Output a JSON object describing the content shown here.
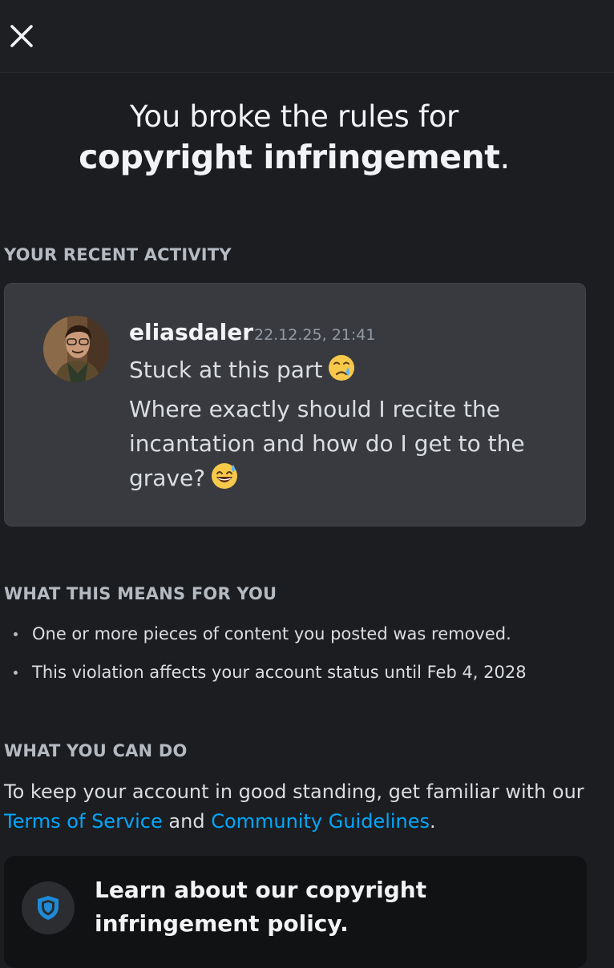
{
  "header": {
    "close_icon": "close-icon"
  },
  "title": {
    "line1": "You broke the rules for",
    "line2_bold": "copyright infringement",
    "line2_suffix": "."
  },
  "recent_activity": {
    "label": "YOUR RECENT ACTIVITY",
    "message": {
      "username": "eliasdaler",
      "timestamp": "22.12.25, 21:41",
      "line1": "Stuck at this part",
      "line1_emoji": "crying-face-emoji",
      "line2": "Where exactly should I recite the incantation and how do I get to the grave?",
      "line2_emoji": "grinning-sweat-emoji"
    }
  },
  "means": {
    "label": "WHAT THIS MEANS FOR YOU",
    "bullets": [
      "One or more pieces of content you posted was removed.",
      "This violation affects your account status until Feb 4, 2028"
    ]
  },
  "can_do": {
    "label": "WHAT YOU CAN DO",
    "text_before": "To keep your account in good standing, get familiar with our ",
    "tos_link": "Terms of Service",
    "and": " and ",
    "guidelines_link": "Community Guidelines",
    "period": "."
  },
  "policy_card": {
    "text": "Learn about our copyright infringement policy.",
    "icon": "shield-icon"
  },
  "colors": {
    "background": "#1c1d21",
    "card": "#383a40",
    "link": "#00a8fc",
    "policy_card": "#111214"
  }
}
